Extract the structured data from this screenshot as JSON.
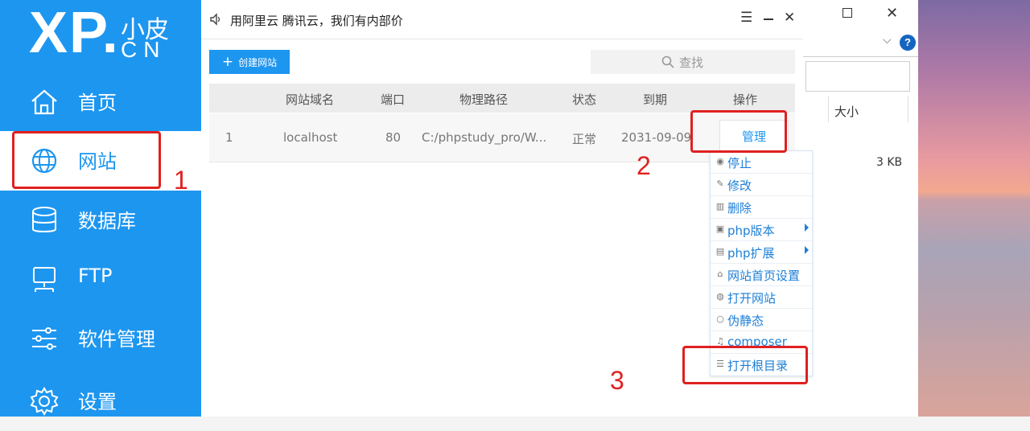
{
  "sidebar": {
    "logo_main": "XP.",
    "logo_small": "小皮",
    "logo_cn": "CN",
    "items": [
      {
        "label": "首页",
        "icon": "home-icon"
      },
      {
        "label": "网站",
        "icon": "globe-icon"
      },
      {
        "label": "数据库",
        "icon": "database-icon"
      },
      {
        "label": "FTP",
        "icon": "ftp-icon"
      },
      {
        "label": "软件管理",
        "icon": "sliders-icon"
      },
      {
        "label": "设置",
        "icon": "gear-icon"
      }
    ]
  },
  "window": {
    "title": "用阿里云 腾讯云，我们有内部价"
  },
  "toolbar": {
    "create_label": "创建网站",
    "search_placeholder": "查找"
  },
  "table": {
    "headers": [
      "网站域名",
      "端口",
      "物理路径",
      "状态",
      "到期",
      "操作"
    ],
    "rows": [
      {
        "index": "1",
        "domain": "localhost",
        "port": "80",
        "path": "C:/phpstudy_pro/W...",
        "status": "正常",
        "expiry": "2031-09-09",
        "action": "管理"
      }
    ]
  },
  "menu": {
    "items": [
      {
        "label": "停止",
        "icon": "stop-icon"
      },
      {
        "label": "修改",
        "icon": "edit-icon"
      },
      {
        "label": "删除",
        "icon": "trash-icon"
      },
      {
        "label": "php版本",
        "icon": "php-version-icon"
      },
      {
        "label": "php扩展",
        "icon": "php-extension-icon"
      },
      {
        "label": "网站首页设置",
        "icon": "home-icon"
      },
      {
        "label": "打开网站",
        "icon": "globe-icon"
      },
      {
        "label": "伪静态",
        "icon": "rewrite-icon"
      },
      {
        "label": "composer",
        "icon": "composer-icon"
      },
      {
        "label": "打开根目录",
        "icon": "list-icon"
      }
    ]
  },
  "explorer": {
    "col_size": "大小",
    "file_size": "3 KB",
    "help": "?"
  },
  "annotations": [
    "1",
    "2",
    "3"
  ],
  "colors": {
    "accent": "#1d96f0",
    "annotation": "#e02020"
  }
}
